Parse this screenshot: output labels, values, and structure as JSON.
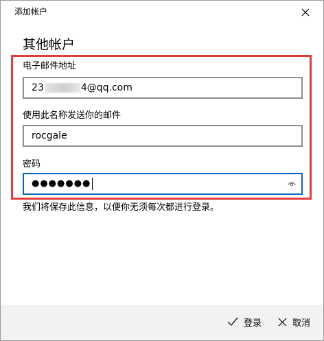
{
  "window": {
    "title": "添加帐户"
  },
  "page": {
    "title": "其他帐户"
  },
  "email": {
    "label": "电子邮件地址",
    "value_prefix": "23",
    "value_suffix": "4@qq.com"
  },
  "sender_name": {
    "label": "使用此名称发送你的邮件",
    "value": "rocgale"
  },
  "password": {
    "label": "密码",
    "masked_value": "●●●●●●●"
  },
  "info": {
    "text": "我们将保存此信息，以便你无须每次都进行登录。"
  },
  "footer": {
    "signin_label": "登录",
    "cancel_label": "取消"
  },
  "colors": {
    "highlight": "#e23b3b",
    "focus_border": "#0a64c8",
    "input_border": "#8e8e8e",
    "footer_bg": "#f2f2f2"
  }
}
